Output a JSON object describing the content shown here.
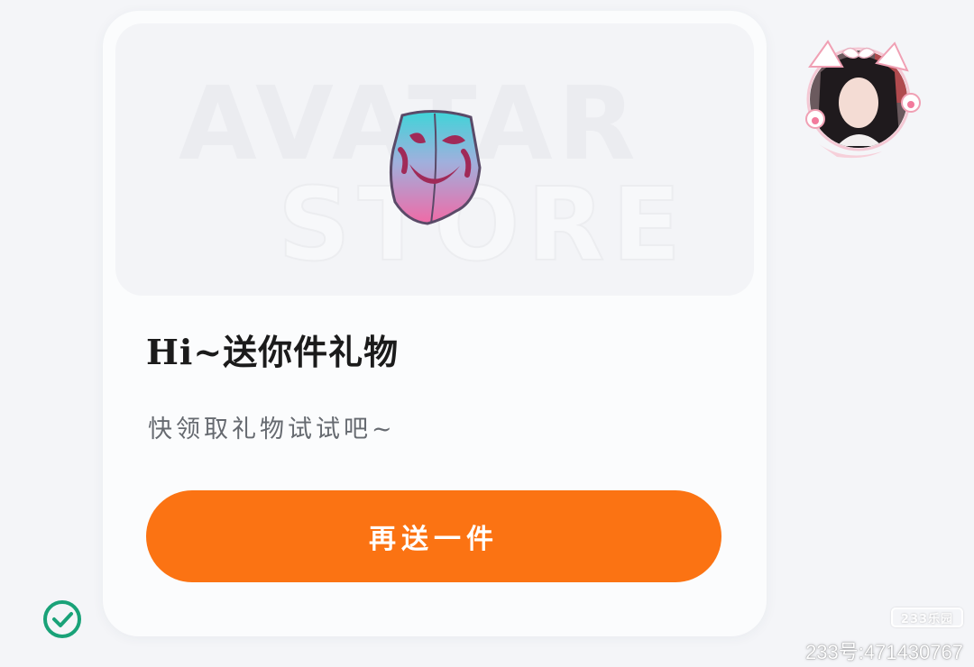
{
  "banner": {
    "watermark_line1": "AVATAR",
    "watermark_line2": "STORE"
  },
  "gift": {
    "title": "Hi~送你件礼物",
    "subtitle": "快领取礼物试试吧~",
    "button_label": "再送一件"
  },
  "colors": {
    "accent": "#fb7313",
    "card_background": "#fbfcfd",
    "page_background": "#f4f5f8",
    "check": "#19a278"
  },
  "icons": {
    "gift_item": "mask-skirt-icon",
    "avatar": "user-avatar",
    "status": "check-circle-icon"
  },
  "overlay": {
    "site_logo": "233乐园",
    "account_id": "233号:471430767"
  }
}
